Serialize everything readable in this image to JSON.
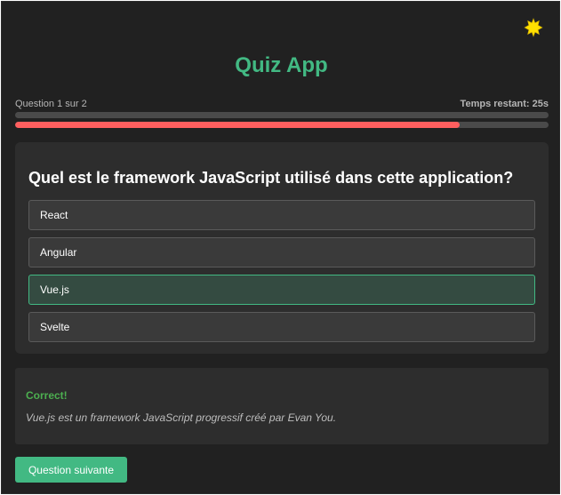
{
  "header": {
    "title": "Quiz App",
    "theme_toggle_icon": "sun-icon"
  },
  "progress": {
    "question_label": "Question 1 sur 2",
    "timer_label": "Temps restant: 25s",
    "question_progress": 0,
    "time_remaining_fraction": 0.833
  },
  "question": {
    "text": "Quel est le framework JavaScript utilisé dans cette application?",
    "options": [
      {
        "label": "React",
        "state": "default"
      },
      {
        "label": "Angular",
        "state": "default"
      },
      {
        "label": "Vue.js",
        "state": "correct"
      },
      {
        "label": "Svelte",
        "state": "default"
      }
    ]
  },
  "feedback": {
    "title": "Correct!",
    "explanation": "Vue.js est un framework JavaScript progressif créé par Evan You."
  },
  "actions": {
    "next_label": "Question suivante"
  },
  "colors": {
    "accent": "#42b983",
    "timer_bar": "#ff5f5f",
    "success": "#4caf50"
  }
}
